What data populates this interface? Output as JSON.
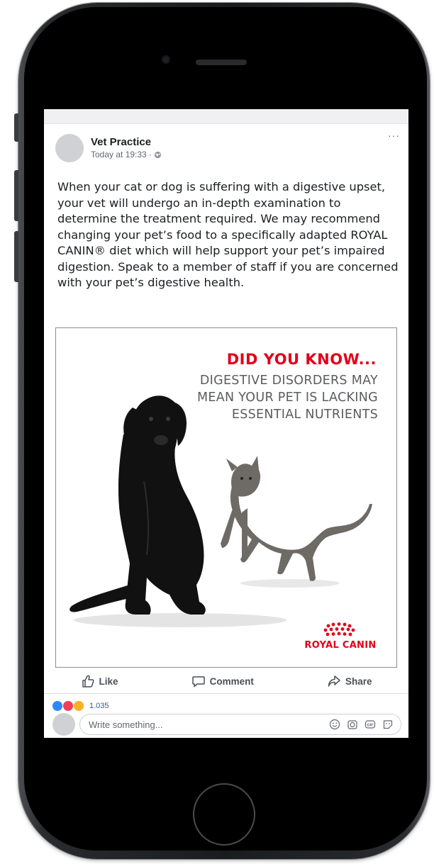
{
  "post": {
    "page_name": "Vet Practice",
    "timestamp": "Today at 19:33 ·",
    "more_label": "···",
    "body": "When your cat or dog is suffering with a digestive upset, your vet will undergo an in-depth examination to determine the treatment required. We may recommend changing your pet’s food to a specifically adapted ROYAL CANIN® diet which will help support your pet’s impaired digestion. Speak to a member of staff if you are concerned with your pet’s digestive health."
  },
  "ad": {
    "headline": "DID YOU KNOW...",
    "subtext": "DIGESTIVE DISORDERS MAY\nMEAN YOUR PET IS LACKING\nESSENTIAL NUTRIENTS",
    "brand": "ROYAL CANIN"
  },
  "actions": {
    "like": "Like",
    "comment": "Comment",
    "share": "Share"
  },
  "reactions": {
    "count": "1.035",
    "types": [
      "like-icon",
      "love-icon",
      "wow-icon"
    ]
  },
  "composer": {
    "placeholder": "Write something...",
    "tools": [
      "emoji-icon",
      "camera-icon",
      "gif-icon",
      "sticker-icon"
    ]
  },
  "colors": {
    "brand_red": "#e2001a",
    "link_blue": "#385898",
    "like_blue": "#2d88ff",
    "love_red": "#f33e58",
    "wow_yellow": "#f7b125"
  }
}
